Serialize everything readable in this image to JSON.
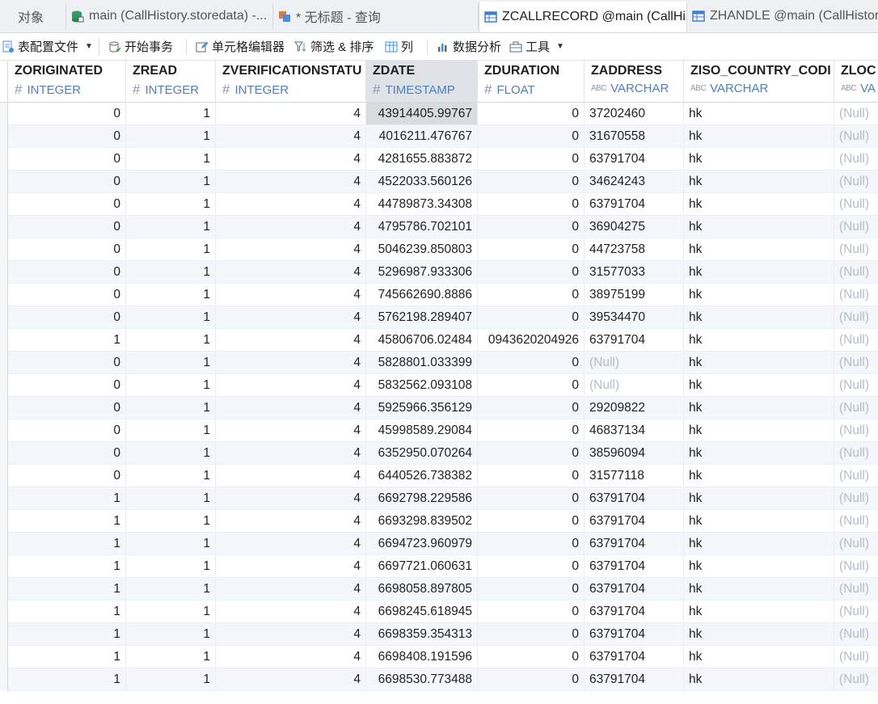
{
  "tabs": [
    {
      "label": "对象",
      "icon": "none",
      "active": false
    },
    {
      "label": "main (CallHistory.storedata) -...",
      "icon": "database-icon",
      "active": false
    },
    {
      "label": "* 无标题 - 查询",
      "icon": "query-icon",
      "active": false
    },
    {
      "label": "ZCALLRECORD @main (CallHi...",
      "icon": "table-icon",
      "active": true
    },
    {
      "label": "ZHANDLE @main (CallHistory",
      "icon": "table-icon",
      "active": false
    }
  ],
  "toolbar": {
    "table_config": "表配置文件",
    "begin_transaction": "开始事务",
    "cell_editor": "单元格编辑器",
    "filter_sort": "筛选 & 排序",
    "columns": "列",
    "data_analysis": "数据分析",
    "tools": "工具"
  },
  "columns": [
    {
      "name": "ZORIGINATED",
      "type": "INTEGER",
      "icon": "hash"
    },
    {
      "name": "ZREAD",
      "type": "INTEGER",
      "icon": "hash"
    },
    {
      "name": "ZVERIFICATIONSTATU",
      "type": "INTEGER",
      "icon": "hash"
    },
    {
      "name": "ZDATE",
      "type": "TIMESTAMP",
      "icon": "hash"
    },
    {
      "name": "ZDURATION",
      "type": "FLOAT",
      "icon": "hash"
    },
    {
      "name": "ZADDRESS",
      "type": "VARCHAR",
      "icon": "abc"
    },
    {
      "name": "ZISO_COUNTRY_CODI",
      "type": "VARCHAR",
      "icon": "abc"
    },
    {
      "name": "ZLOC",
      "type": "VA",
      "icon": "abc"
    }
  ],
  "rows": [
    [
      "0",
      "1",
      "4",
      "43914405.99767",
      "0",
      "37202460",
      "hk",
      "(Null)"
    ],
    [
      "0",
      "1",
      "4",
      "4016211.476767",
      "0",
      "31670558",
      "hk",
      "(Null)"
    ],
    [
      "0",
      "1",
      "4",
      "4281655.883872",
      "0",
      "63791704",
      "hk",
      "(Null)"
    ],
    [
      "0",
      "1",
      "4",
      "4522033.560126",
      "0",
      "34624243",
      "hk",
      "(Null)"
    ],
    [
      "0",
      "1",
      "4",
      "44789873.34308",
      "0",
      "63791704",
      "hk",
      "(Null)"
    ],
    [
      "0",
      "1",
      "4",
      "4795786.702101",
      "0",
      "36904275",
      "hk",
      "(Null)"
    ],
    [
      "0",
      "1",
      "4",
      "5046239.850803",
      "0",
      "44723758",
      "hk",
      "(Null)"
    ],
    [
      "0",
      "1",
      "4",
      "5296987.933306",
      "0",
      "31577033",
      "hk",
      "(Null)"
    ],
    [
      "0",
      "1",
      "4",
      "745662690.8886",
      "0",
      "38975199",
      "hk",
      "(Null)"
    ],
    [
      "0",
      "1",
      "4",
      "5762198.289407",
      "0",
      "39534470",
      "hk",
      "(Null)"
    ],
    [
      "1",
      "1",
      "4",
      "45806706.02484",
      "0943620204926",
      "63791704",
      "hk",
      "(Null)"
    ],
    [
      "0",
      "1",
      "4",
      "5828801.033399",
      "0",
      "(Null)",
      "hk",
      "(Null)"
    ],
    [
      "0",
      "1",
      "4",
      "5832562.093108",
      "0",
      "(Null)",
      "hk",
      "(Null)"
    ],
    [
      "0",
      "1",
      "4",
      "5925966.356129",
      "0",
      "29209822",
      "hk",
      "(Null)"
    ],
    [
      "0",
      "1",
      "4",
      "45998589.29084",
      "0",
      "46837134",
      "hk",
      "(Null)"
    ],
    [
      "0",
      "1",
      "4",
      "6352950.070264",
      "0",
      "38596094",
      "hk",
      "(Null)"
    ],
    [
      "0",
      "1",
      "4",
      "6440526.738382",
      "0",
      "31577118",
      "hk",
      "(Null)"
    ],
    [
      "1",
      "1",
      "4",
      "6692798.229586",
      "0",
      "63791704",
      "hk",
      "(Null)"
    ],
    [
      "1",
      "1",
      "4",
      "6693298.839502",
      "0",
      "63791704",
      "hk",
      "(Null)"
    ],
    [
      "1",
      "1",
      "4",
      "6694723.960979",
      "0",
      "63791704",
      "hk",
      "(Null)"
    ],
    [
      "1",
      "1",
      "4",
      "6697721.060631",
      "0",
      "63791704",
      "hk",
      "(Null)"
    ],
    [
      "1",
      "1",
      "4",
      "6698058.897805",
      "0",
      "63791704",
      "hk",
      "(Null)"
    ],
    [
      "1",
      "1",
      "4",
      "6698245.618945",
      "0",
      "63791704",
      "hk",
      "(Null)"
    ],
    [
      "1",
      "1",
      "4",
      "6698359.354313",
      "0",
      "63791704",
      "hk",
      "(Null)"
    ],
    [
      "1",
      "1",
      "4",
      "6698408.191596",
      "0",
      "63791704",
      "hk",
      "(Null)"
    ],
    [
      "1",
      "1",
      "4",
      "6698530.773488",
      "0",
      "63791704",
      "hk",
      "(Null)"
    ]
  ],
  "colors": {
    "type_text": "#4f7fb8",
    "null_text": "#b5bcc6",
    "alt_row": "#f3f7fc",
    "selected_header": "#dfe3e8"
  }
}
